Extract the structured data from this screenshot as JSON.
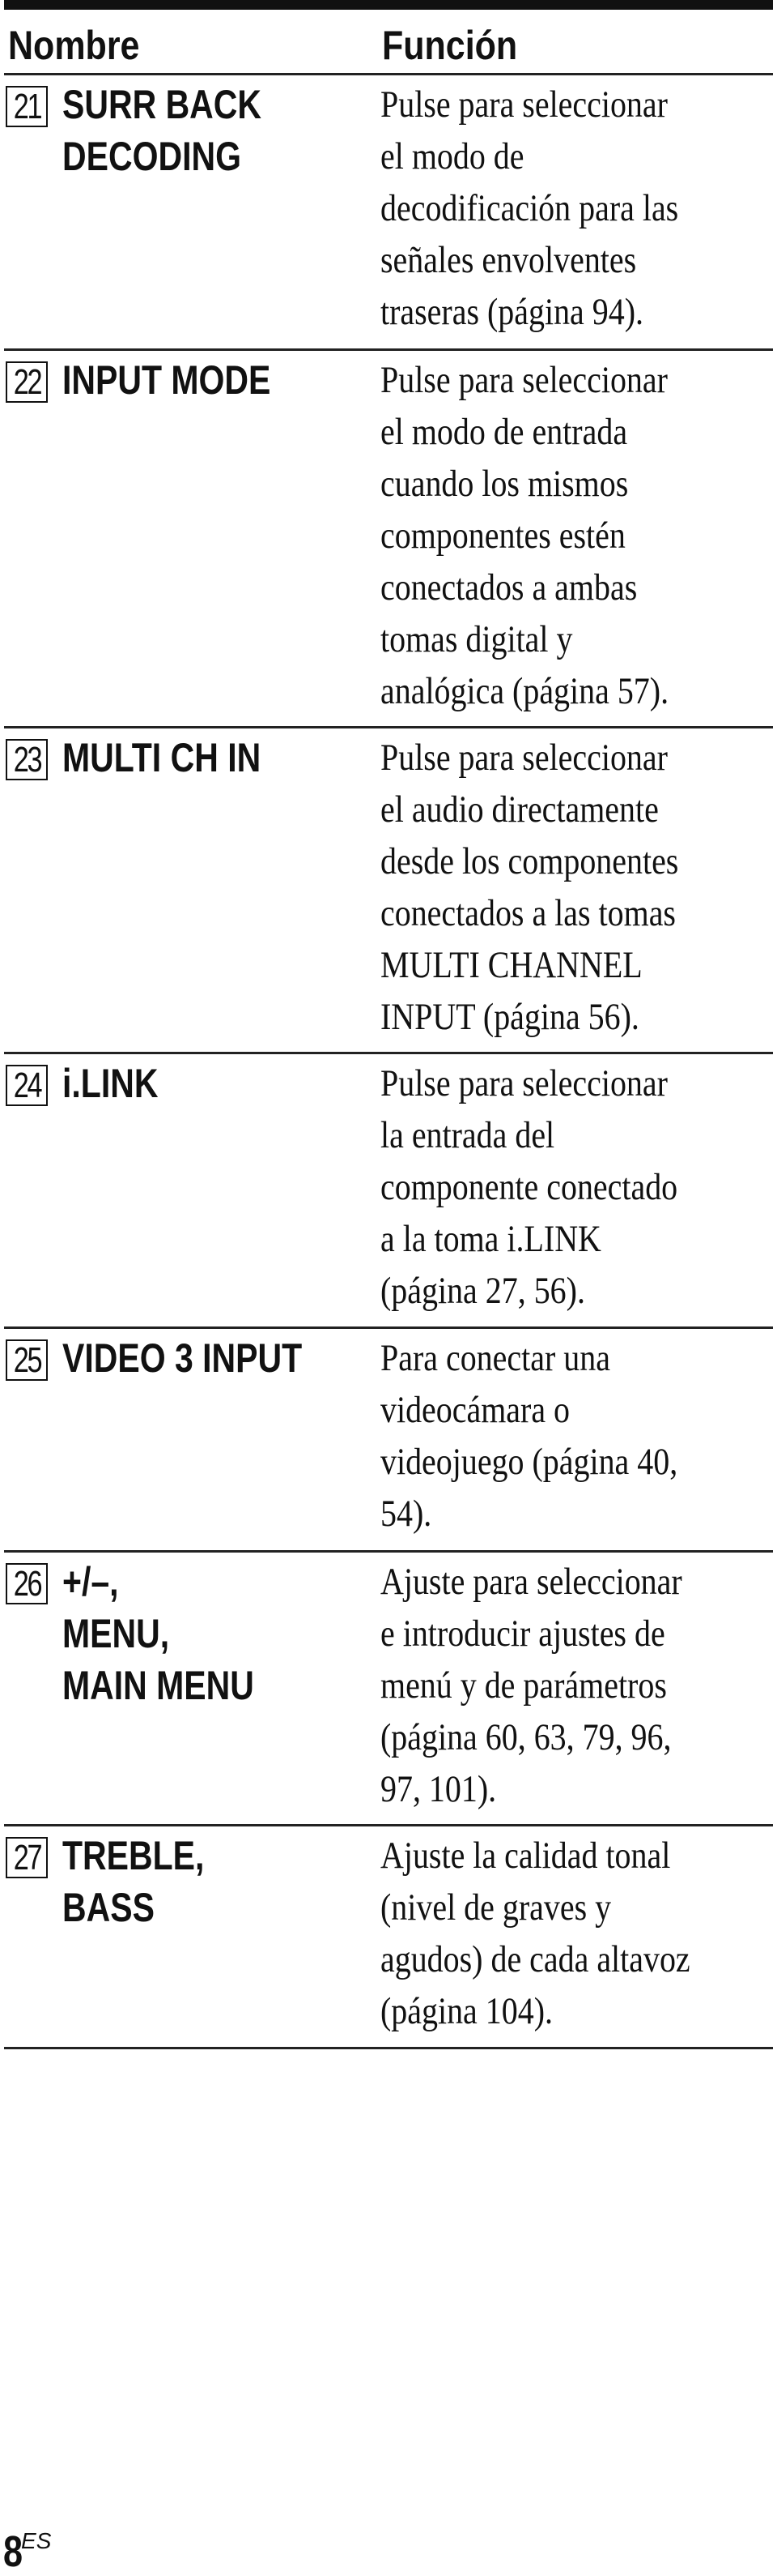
{
  "header": {
    "col_name": "Nombre",
    "col_function": "Función"
  },
  "rows": [
    {
      "number": "21",
      "name_lines": [
        "SURR BACK",
        "DECODING"
      ],
      "desc_lines": [
        "Pulse para seleccionar",
        "el modo de",
        "decodificación para las",
        "señales envolventes",
        "traseras (página 94)."
      ]
    },
    {
      "number": "22",
      "name_lines": [
        "INPUT MODE"
      ],
      "desc_lines": [
        "Pulse para seleccionar",
        "el modo de entrada",
        "cuando los mismos",
        "componentes estén",
        "conectados a ambas",
        "tomas digital y",
        "analógica (página 57)."
      ]
    },
    {
      "number": "23",
      "name_lines": [
        "MULTI CH IN"
      ],
      "desc_lines": [
        "Pulse para seleccionar",
        "el audio directamente",
        "desde los componentes",
        "conectados a las tomas",
        "MULTI CHANNEL",
        "INPUT (página 56)."
      ]
    },
    {
      "number": "24",
      "name_lines": [
        "i.LINK"
      ],
      "desc_lines": [
        "Pulse para seleccionar",
        "la entrada del",
        "componente conectado",
        "a la toma i.LINK",
        "(página 27, 56)."
      ]
    },
    {
      "number": "25",
      "name_lines": [
        "VIDEO 3 INPUT"
      ],
      "desc_lines": [
        "Para conectar una",
        "videocámara o",
        "videojuego (página 40,",
        "54)."
      ]
    },
    {
      "number": "26",
      "name_lines": [
        "+/–,",
        "MENU,",
        "MAIN MENU"
      ],
      "desc_lines": [
        "Ajuste para seleccionar",
        "e introducir ajustes de",
        "menú y de parámetros",
        "(página 60, 63, 79, 96,",
        "97, 101)."
      ]
    },
    {
      "number": "27",
      "name_lines": [
        "TREBLE,",
        "BASS"
      ],
      "desc_lines": [
        "Ajuste la calidad tonal",
        "(nivel de graves y",
        "agudos) de cada altavoz",
        "(página 104)."
      ]
    }
  ],
  "footer": {
    "page_number": "8",
    "language_code": "ES"
  }
}
